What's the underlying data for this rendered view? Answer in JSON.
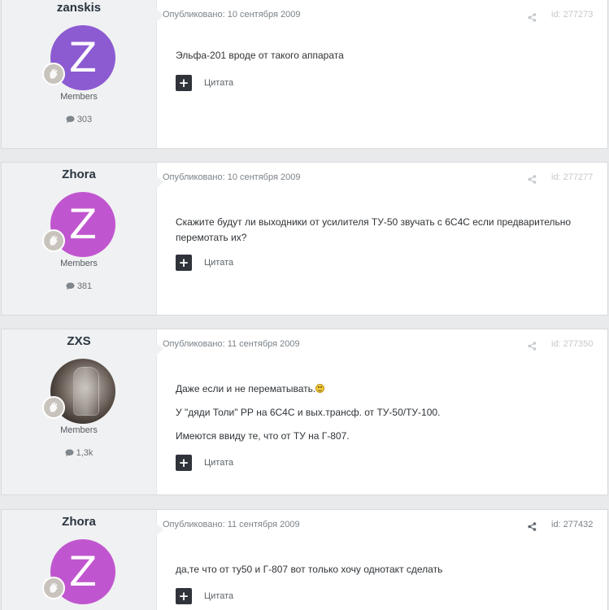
{
  "posts": [
    {
      "author": "zanskis",
      "avatar_letter": "Z",
      "avatar_color": "#8c5bd1",
      "group": "Members",
      "post_count": "303",
      "published": "Опубликовано: 10 сентября 2009",
      "post_id": "id: 277273",
      "paragraphs": [
        "Эльфа-201 вроде от такого аппарата"
      ],
      "quote_label": "Цитата"
    },
    {
      "author": "Zhora",
      "avatar_letter": "Z",
      "avatar_color": "#c056cf",
      "group": "Members",
      "post_count": "381",
      "published": "Опубликовано: 10 сентября 2009",
      "post_id": "id: 277277",
      "paragraphs": [
        "Скажите будут ли выходники от усилителя ТУ-50 звучать с 6С4С если предварительно перемотать их?"
      ],
      "quote_label": "Цитата"
    },
    {
      "author": "ZXS",
      "avatar_letter": "",
      "avatar_color": "#4a403a",
      "group": "Members",
      "post_count": "1,3k",
      "published": "Опубликовано: 11 сентября 2009",
      "post_id": "id: 277350",
      "paragraphs": [
        "Даже если и не перематывать.",
        "У \"дяди Толи\" РР на 6С4С и вых.трансф. от ТУ-50/ТУ-100.",
        "Имеются ввиду те, что от ТУ на Г-807."
      ],
      "quote_label": "Цитата"
    },
    {
      "author": "Zhora",
      "avatar_letter": "Z",
      "avatar_color": "#c056cf",
      "group": "Members",
      "post_count": "",
      "published": "Опубликовано: 11 сентября 2009",
      "post_id": "id: 277432",
      "paragraphs": [
        "да,те что от ту50 и Г-807 вот только хочу однотакт сделать"
      ],
      "quote_label": "Цитата"
    }
  ],
  "icons": {
    "share": "share-icon",
    "comment": "comment-icon",
    "badge": "rank-badge-icon",
    "quote": "plus-icon",
    "smiley": "smiley-icon"
  }
}
